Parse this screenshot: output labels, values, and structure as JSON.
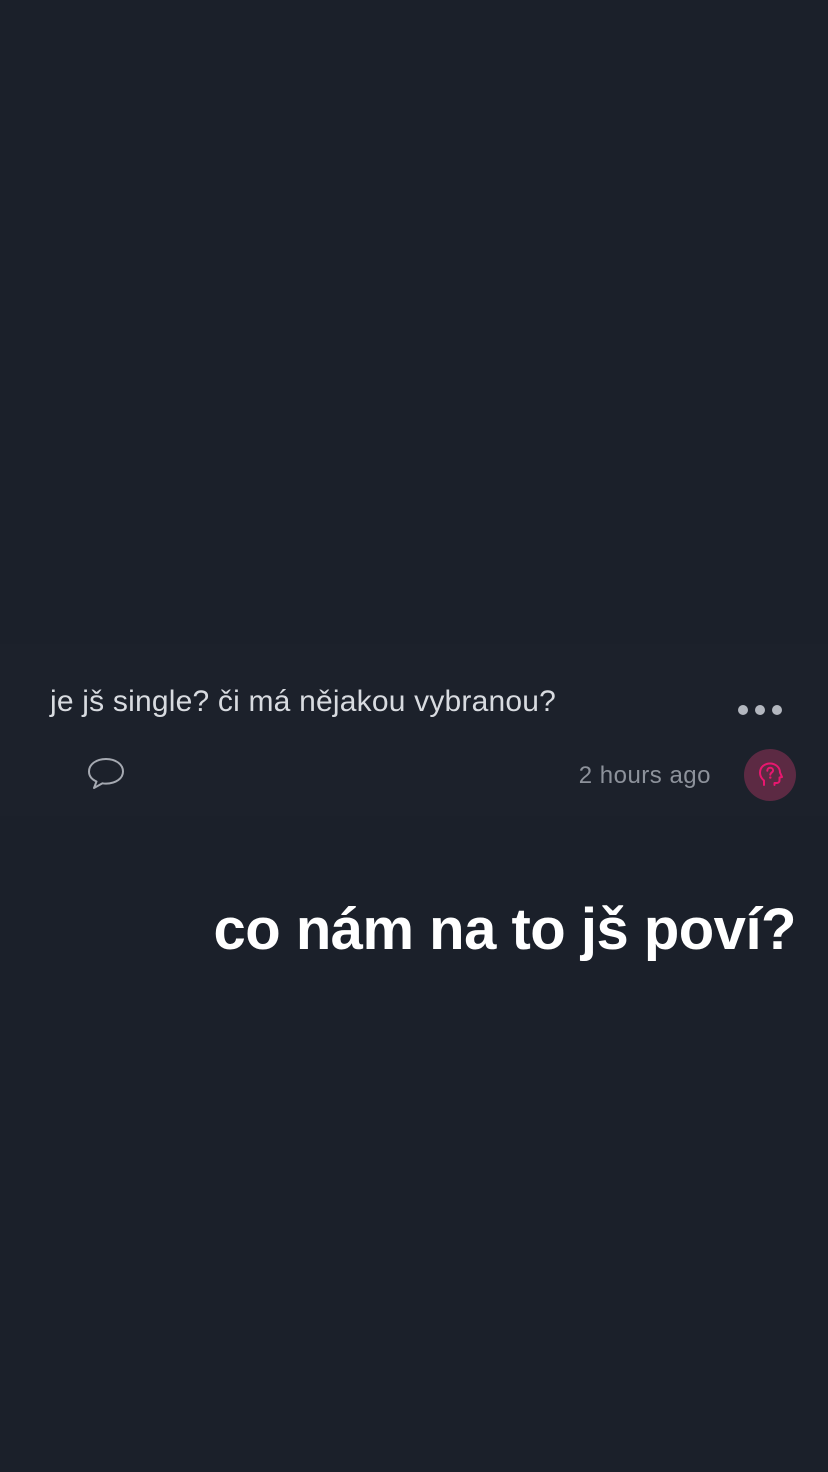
{
  "post": {
    "question": "je jš single? či má nějakou vybranou?",
    "timestamp": "2 hours ago",
    "more_icon": "more-horizontal-icon",
    "comment_icon": "speech-bubble-icon",
    "avatar_icon": "anonymous-head-question-icon"
  },
  "overlay": {
    "caption": "co nám na to jš poví?"
  },
  "colors": {
    "background": "#1b202a",
    "avatar_bg": "#5c2a43",
    "avatar_accent": "#e8176f"
  }
}
